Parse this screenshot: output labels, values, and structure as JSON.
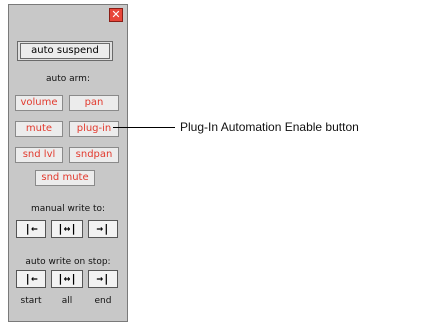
{
  "window": {
    "close_glyph": "✕",
    "auto_suspend_label": "auto suspend",
    "auto_arm_label": "auto arm:",
    "arm_buttons": [
      {
        "label": "volume"
      },
      {
        "label": "pan"
      },
      {
        "label": "mute"
      },
      {
        "label": "plug-in"
      },
      {
        "label": "snd lvl"
      },
      {
        "label": "sndpan"
      },
      {
        "label": "snd mute"
      }
    ],
    "manual_write_label": "manual write to:",
    "manual_write_buttons": [
      {
        "glyph": "|←",
        "icon": "write-to-start-icon"
      },
      {
        "glyph": "|↔|",
        "icon": "write-to-all-icon"
      },
      {
        "glyph": "→|",
        "icon": "write-to-end-icon"
      }
    ],
    "auto_write_label": "auto write on stop:",
    "auto_write_buttons": [
      {
        "glyph": "|←",
        "icon": "write-to-start-icon"
      },
      {
        "glyph": "|↔|",
        "icon": "write-to-all-icon"
      },
      {
        "glyph": "→|",
        "icon": "write-to-end-icon"
      }
    ],
    "auto_write_captions": [
      "start",
      "all",
      "end"
    ]
  },
  "callout": {
    "text": "Plug-In Automation Enable button"
  },
  "colors": {
    "panel_bg": "#c8c8c8",
    "arm_text": "#e23a2e",
    "close_bg": "#e8463a"
  }
}
